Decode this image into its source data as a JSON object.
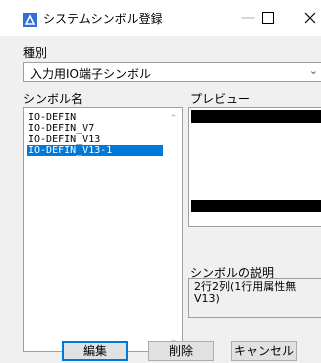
{
  "window": {
    "title": "システムシンボル登録",
    "minimize_glyph": "—",
    "maximize_glyph": "☐",
    "close_glyph": "✕"
  },
  "type_field": {
    "label": "種別",
    "value": "入力用IO端子シンボル"
  },
  "symbol_list": {
    "label": "シンボル名",
    "items": [
      "IO-DEFIN",
      "IO-DEFIN_V7",
      "IO-DEFIN_V13",
      "IO-DEFIN_V13-1"
    ],
    "selected_index": 3
  },
  "preview": {
    "label": "プレビュー"
  },
  "description": {
    "label": "シンボルの説明",
    "text": "2行2列(1行用属性無V13)"
  },
  "buttons": {
    "edit": "編集",
    "delete": "削除",
    "cancel": "キャンセル"
  },
  "colors": {
    "selection": "#0078d7",
    "app_icon": "#2f6fd6"
  }
}
